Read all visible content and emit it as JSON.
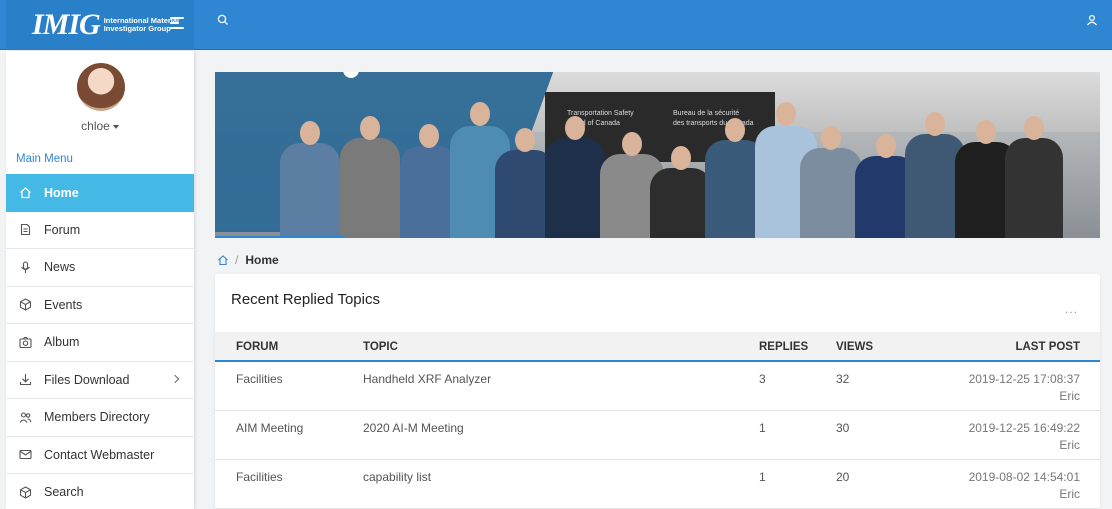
{
  "header": {
    "logo_mark": "IMIG",
    "logo_text": "International Material Investigator Group"
  },
  "sidebar": {
    "username": "chloe",
    "menu_title": "Main Menu",
    "items": [
      {
        "label": "Home",
        "icon": "home-icon",
        "active": true
      },
      {
        "label": "Forum",
        "icon": "document-icon"
      },
      {
        "label": "News",
        "icon": "microphone-icon"
      },
      {
        "label": "Events",
        "icon": "cube-icon"
      },
      {
        "label": "Album",
        "icon": "camera-icon"
      },
      {
        "label": "Files Download",
        "icon": "download-icon",
        "has_submenu": true
      },
      {
        "label": "Members Directory",
        "icon": "users-icon"
      },
      {
        "label": "Contact Webmaster",
        "icon": "mail-icon"
      },
      {
        "label": "Search",
        "icon": "cube-icon"
      }
    ]
  },
  "banner": {
    "sign_line1": "Transportation Safety",
    "sign_line2": "Board of Canada",
    "sign_line3": "Bureau de la sécurité",
    "sign_line4": "des transports du Canada"
  },
  "breadcrumb": {
    "separator": "/",
    "current": "Home"
  },
  "recent_topics": {
    "title": "Recent Replied Topics",
    "more": "...",
    "columns": {
      "forum": "FORUM",
      "topic": "TOPIC",
      "replies": "REPLIES",
      "views": "VIEWS",
      "last_post": "LAST POST"
    },
    "rows": [
      {
        "forum": "Facilities",
        "topic": "Handheld XRF Analyzer",
        "replies": "3",
        "views": "32",
        "date": "2019-12-25 17:08:37",
        "author": "Eric"
      },
      {
        "forum": "AIM Meeting",
        "topic": "2020 AI-M Meeting",
        "replies": "1",
        "views": "30",
        "date": "2019-12-25 16:49:22",
        "author": "Eric"
      },
      {
        "forum": "Facilities",
        "topic": "capability list",
        "replies": "1",
        "views": "20",
        "date": "2019-08-02 14:54:01",
        "author": "Eric"
      }
    ]
  },
  "colors": {
    "primary": "#2f86d3",
    "active_menu": "#45b9e6"
  }
}
